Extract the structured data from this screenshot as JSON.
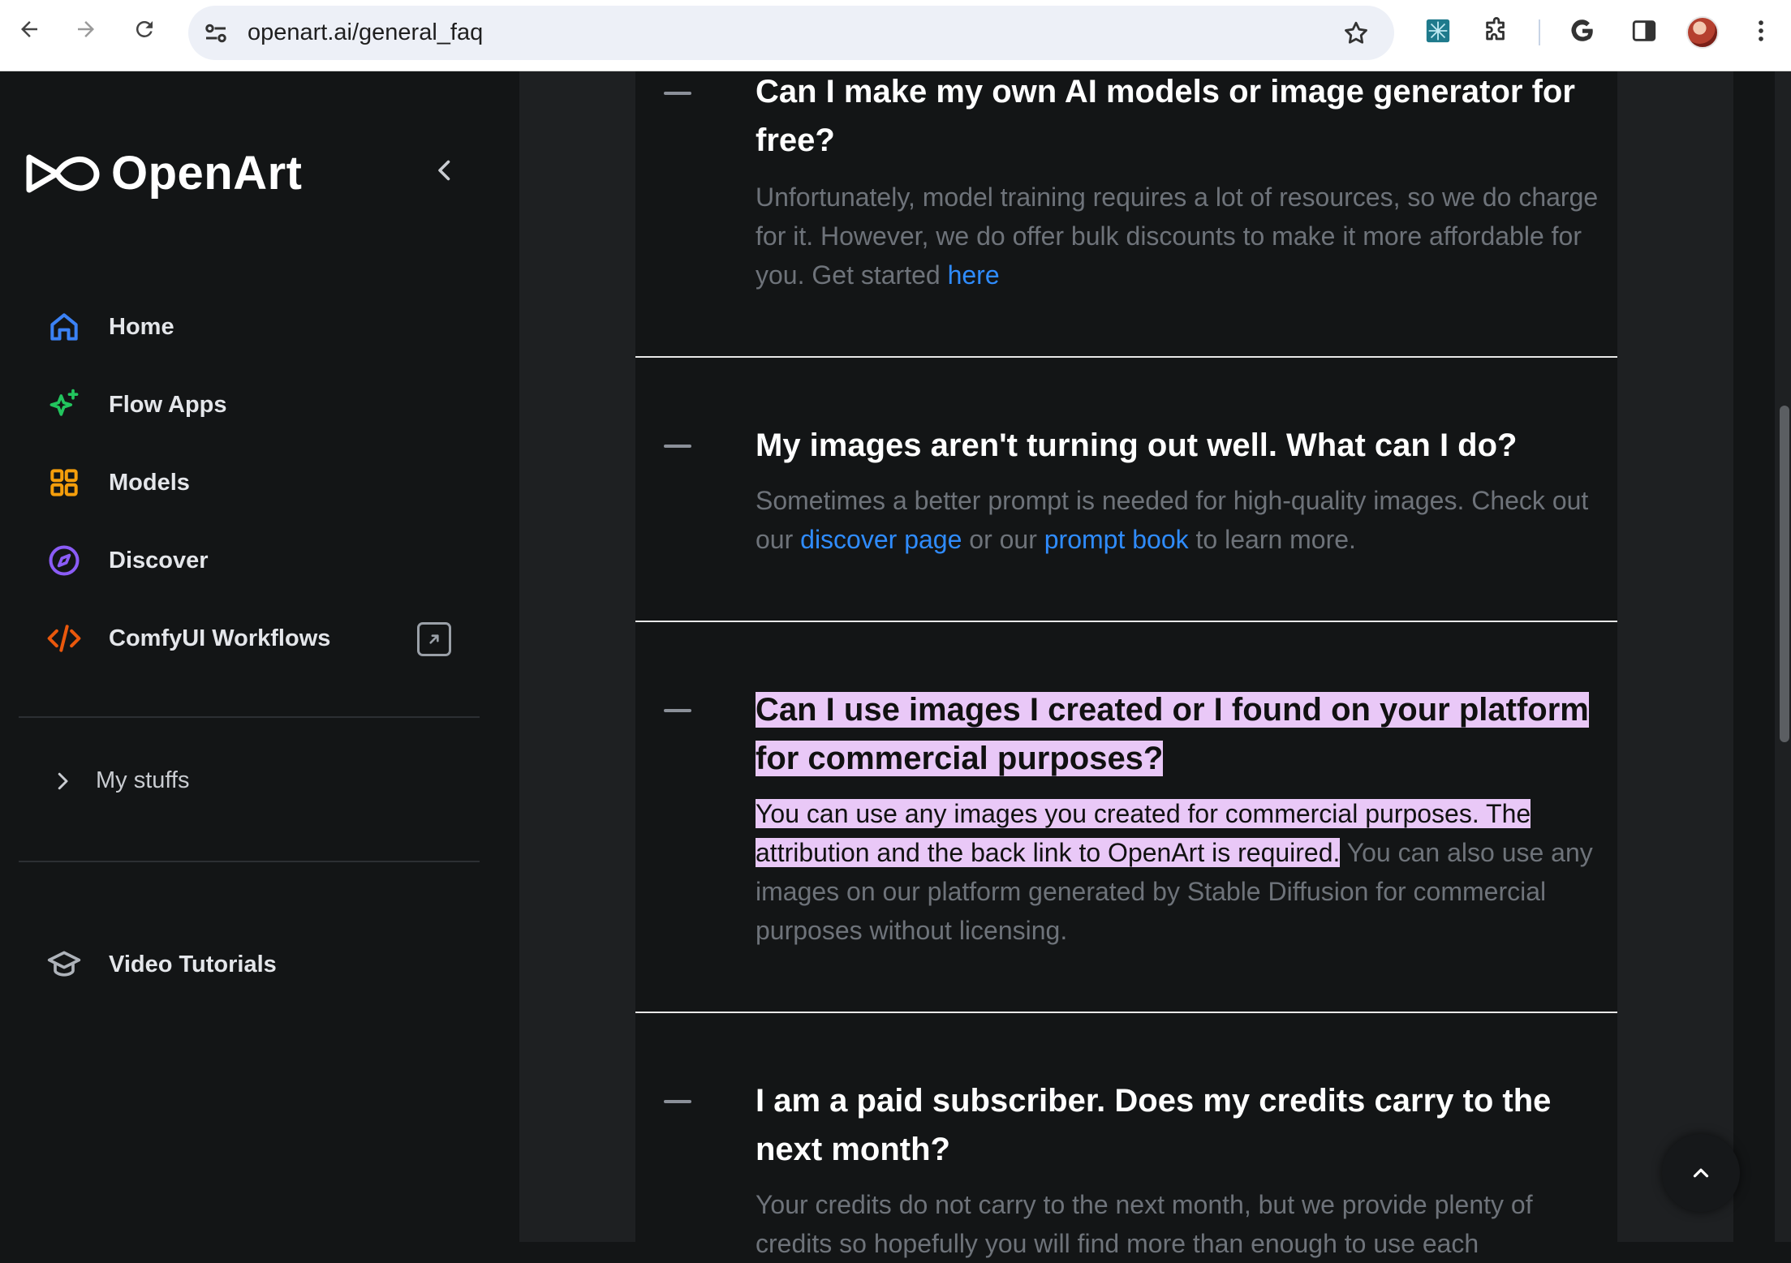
{
  "browser": {
    "url": "openart.ai/general_faq"
  },
  "sidebar": {
    "brand": "OpenArt",
    "items": [
      {
        "label": "Home",
        "icon": "home-icon",
        "color": "#3b82f6"
      },
      {
        "label": "Flow Apps",
        "icon": "sparkle-icon",
        "color": "#22c55e"
      },
      {
        "label": "Models",
        "icon": "grid-icon",
        "color": "#f59e0b"
      },
      {
        "label": "Discover",
        "icon": "compass-icon",
        "color": "#8b5cf6"
      },
      {
        "label": "ComfyUI Workflows",
        "icon": "code-icon",
        "color": "#ea580c"
      }
    ],
    "my_stuffs": "My stuffs",
    "video_tutorials": "Video Tutorials"
  },
  "faq": [
    {
      "question": "Can I make my own AI models or image generator for free?",
      "answer_text": "Unfortunately, model training requires a lot of resources, so we do charge for it. However, we do offer bulk discounts to make it more affordable for you. Get started ",
      "answer_link": "here"
    },
    {
      "question": "My images aren't turning out well. What can I do?",
      "answer_pre": "Sometimes a better prompt is needed for high-quality images. Check out our ",
      "link1": "discover page",
      "answer_mid": " or our ",
      "link2": "prompt book",
      "answer_post": " to learn more."
    },
    {
      "question": "Can I use images I created or I found on your platform for commercial purposes?",
      "answer_highlight": "You can use any images you created for commercial purposes. The attribution and the back link to OpenArt is required.",
      "answer_rest": " You can also use any images on our platform generated by Stable Diffusion for commercial purposes without licensing."
    },
    {
      "question": "I am a paid subscriber. Does my credits carry to the next month?",
      "answer_text": "Your credits do not carry to the next month, but we provide plenty of credits so hopefully you will find more than enough to use each"
    }
  ],
  "colors": {
    "highlight": "#e9c8f7",
    "link": "#2f8cff"
  }
}
